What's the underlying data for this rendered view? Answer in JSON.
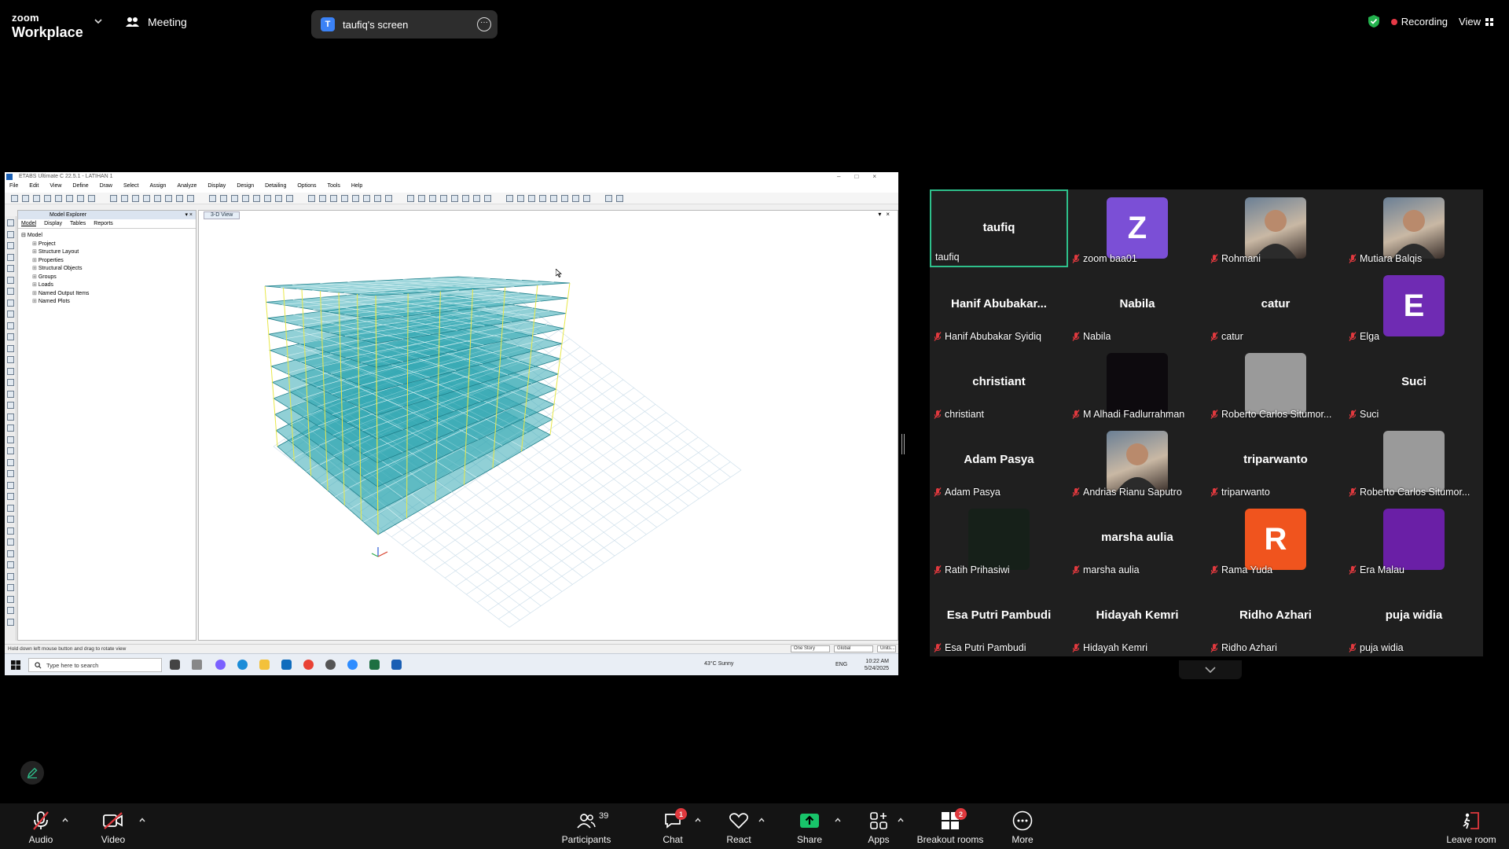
{
  "topbar": {
    "brand_line1": "zoom",
    "brand_line2": "Workplace",
    "meeting_label": "Meeting",
    "share_badge": "T",
    "share_title": "taufiq's screen",
    "recording_label": "Recording",
    "view_label": "View"
  },
  "shared_screen": {
    "window_title": "ETABS Ultimate C 22.5.1 - LATIHAN 1",
    "menu": [
      "File",
      "Edit",
      "View",
      "Define",
      "Draw",
      "Select",
      "Assign",
      "Analyze",
      "Display",
      "Design",
      "Detailing",
      "Options",
      "Tools",
      "Help"
    ],
    "explorer_title": "Model Explorer",
    "explorer_tabs": [
      "Model",
      "Display",
      "Tables",
      "Reports"
    ],
    "tree_root": "Model",
    "tree_items": [
      "Project",
      "Structure Layout",
      "Properties",
      "Structural Objects",
      "Groups",
      "Loads",
      "Named Output Items",
      "Named Plots"
    ],
    "view_tab": "3-D View",
    "status_hint": "Hold down left mouse button and drag to rotate view",
    "story_select": "One Story",
    "coord_select": "Global",
    "units_button": "Units...",
    "taskbar_search": "Type here to search",
    "weather": "43°C  Sunny",
    "tray_lang": "ENG",
    "time": "10:22 AM",
    "date": "5/24/2025"
  },
  "gallery": {
    "participants": [
      {
        "name": "taufiq",
        "display": "taufiq",
        "active": true,
        "muted": false
      },
      {
        "name": "zoom baa01",
        "avatar_letter": "Z",
        "avatar_color": "#7b4fd6",
        "muted": true
      },
      {
        "name": "Rohmani",
        "photo": "photo-icon",
        "muted": true
      },
      {
        "name": "Mutiara Balqis",
        "photo": "photo-icon",
        "muted": true
      },
      {
        "name": "Hanif Abubakar Syidiq",
        "display": "Hanif  Abubakar...",
        "muted": true
      },
      {
        "name": "Nabila",
        "display": "Nabila",
        "muted": true
      },
      {
        "name": "catur",
        "display": "catur",
        "muted": true
      },
      {
        "name": "Elga",
        "avatar_letter": "E",
        "avatar_color": "#6f2bb3",
        "muted": true
      },
      {
        "name": "christiant",
        "display": "christiant",
        "muted": true
      },
      {
        "name": "M Alhadi Fadlurrahman",
        "avatar_color": "#0d0a0e",
        "muted": true
      },
      {
        "name": "Roberto Carlos Situmor...",
        "avatar_color": "#9a9a9a",
        "muted": true
      },
      {
        "name": "Suci",
        "display": "Suci",
        "muted": true
      },
      {
        "name": "Adam Pasya",
        "display": "Adam Pasya",
        "muted": true
      },
      {
        "name": "Andrias Rianu Saputro",
        "photo": "photo-icon",
        "muted": true
      },
      {
        "name": "triparwanto",
        "display": "triparwanto",
        "muted": true
      },
      {
        "name": "Roberto Carlos Situmor...",
        "avatar_color": "#9a9a9a",
        "muted": true
      },
      {
        "name": "Ratih Prihasiwi",
        "avatar_color": "#162019",
        "muted": true
      },
      {
        "name": "marsha aulia",
        "display": "marsha aulia",
        "muted": true
      },
      {
        "name": "Rama Yuda",
        "avatar_letter": "R",
        "avatar_color": "#f0541e",
        "muted": true
      },
      {
        "name": "Era Malau",
        "avatar_color": "#6a1fa6",
        "muted": true
      },
      {
        "name": "Esa Putri Pambudi",
        "display": "Esa Putri Pambudi",
        "muted": true
      },
      {
        "name": "Hidayah Kemri",
        "display": "Hidayah Kemri",
        "muted": true
      },
      {
        "name": "Ridho Azhari",
        "display": "Ridho Azhari",
        "muted": true
      },
      {
        "name": "puja widia",
        "display": "puja widia",
        "muted": true
      }
    ]
  },
  "toolbar": {
    "audio": "Audio",
    "video": "Video",
    "participants": "Participants",
    "participants_count": "39",
    "chat": "Chat",
    "chat_badge": "1",
    "react": "React",
    "share": "Share",
    "apps": "Apps",
    "breakout": "Breakout rooms",
    "breakout_badge": "2",
    "more": "More",
    "leave": "Leave room"
  },
  "colors": {
    "accent_green": "#2ec08b",
    "share_green": "#18c46a",
    "mic_off_red": "#e0393e",
    "slab_teal": "#36a9b4"
  }
}
